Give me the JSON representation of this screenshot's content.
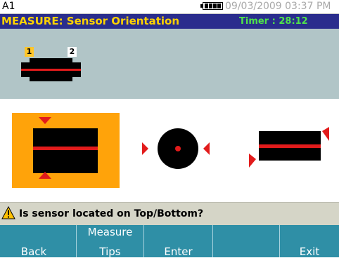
{
  "status": {
    "id": "A1",
    "datetime": "09/03/2009 03:37 PM"
  },
  "header": {
    "title": "MEASURE: Sensor Orientation",
    "timer": "Timer : 28:12"
  },
  "sensor_panel": {
    "sensor_1": "1",
    "sensor_2": "2"
  },
  "options": [
    {
      "name": "Top/Bottom",
      "selected": true
    },
    {
      "name": "Center"
    },
    {
      "name": "Side"
    }
  ],
  "prompt": {
    "question": "Is sensor located on Top/Bottom?",
    "icon": "warning-icon"
  },
  "softkeys": [
    {
      "line1": "",
      "line2": "Back"
    },
    {
      "line1": "Measure",
      "line2": "Tips"
    },
    {
      "line1": "",
      "line2": "Enter"
    },
    {
      "line1": "",
      "line2": ""
    },
    {
      "line1": "",
      "line2": "Exit"
    }
  ],
  "colors": {
    "title_bg": "#2a2d8d",
    "title_text": "#ffd200",
    "timer_text": "#50e34a",
    "selected_bg": "#ffa30a",
    "softkey_bg": "#2f8fa6",
    "panel_bg": "#b1c5c7",
    "accent_red": "#e21b1b"
  }
}
